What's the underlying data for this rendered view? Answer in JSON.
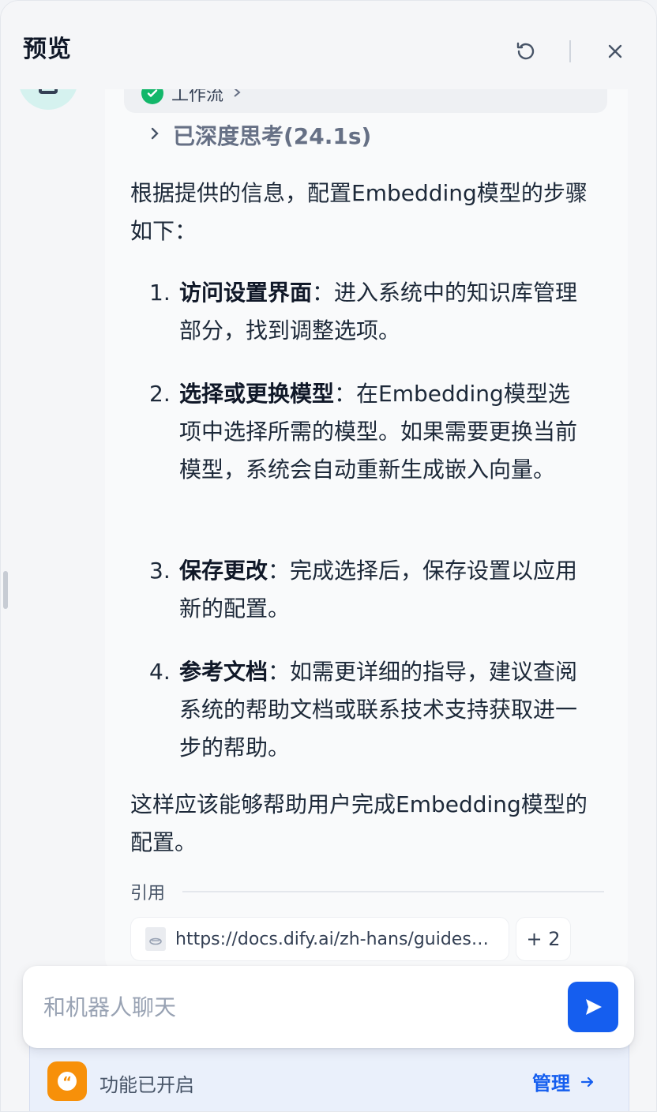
{
  "header": {
    "title": "预览",
    "refresh_icon": "refresh-icon",
    "close_icon": "close-icon"
  },
  "message": {
    "workflow_label": "工作流",
    "thinking_label": "已深度思考(24.1s)",
    "intro": "根据提供的信息，配置Embedding模型的步骤如下：",
    "steps": [
      {
        "num": "1.",
        "title": "访问设置界面",
        "text": "：进入系统中的知识库管理部分，找到调整选项。"
      },
      {
        "num": "2.",
        "title": "选择或更换模型",
        "text": "：在Embedding模型选项中选择所需的模型。如果需要更换当前模型，系统会自动重新生成嵌入向量。"
      },
      {
        "num": "3.",
        "title": "保存更改",
        "text": "：完成选择后，保存设置以应用新的配置。"
      },
      {
        "num": "4.",
        "title": "参考文档",
        "text": "：如需更详细的指导，建议查阅系统的帮助文档或联系技术支持获取进一步的帮助。"
      }
    ],
    "outro": "这样应该能够帮助用户完成Embedding模型的配置。",
    "citations": {
      "label": "引用",
      "first_url": "https://docs.dify.ai/zh-hans/guides/knowledge-base",
      "more": "+ 2"
    }
  },
  "composer": {
    "placeholder": "和机器人聊天"
  },
  "feature_bar": {
    "label": "功能已开启",
    "manage": "管理"
  },
  "colors": {
    "accent": "#155eef",
    "success": "#12b76a",
    "feature_icon": "#f79009"
  }
}
